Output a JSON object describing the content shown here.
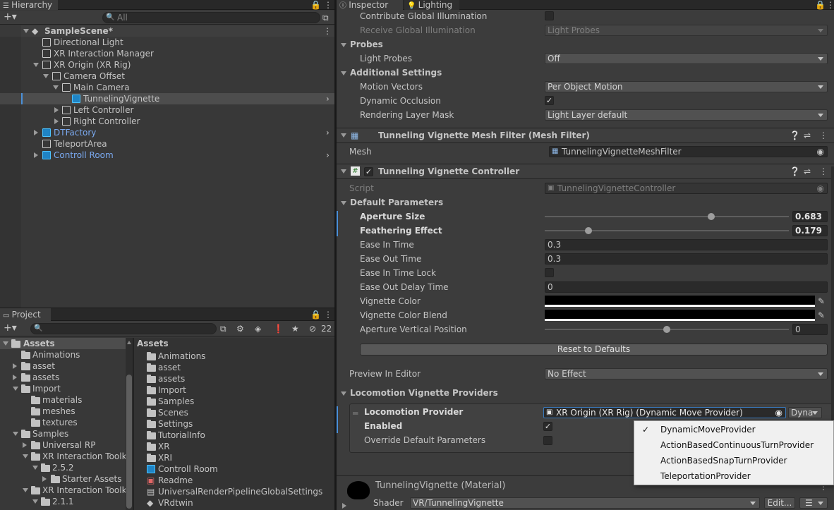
{
  "hierarchy": {
    "tab": "Hierarchy",
    "search_placeholder": "All",
    "items": [
      {
        "label": "SampleScene*"
      },
      {
        "label": "Directional Light"
      },
      {
        "label": "XR Interaction Manager"
      },
      {
        "label": "XR Origin (XR Rig)"
      },
      {
        "label": "Camera Offset"
      },
      {
        "label": "Main Camera"
      },
      {
        "label": "TunnelingVignette"
      },
      {
        "label": "Left Controller"
      },
      {
        "label": "Right Controller"
      },
      {
        "label": "DTFactory"
      },
      {
        "label": "TeleportArea"
      },
      {
        "label": "Controll Room"
      }
    ]
  },
  "project": {
    "tab": "Project",
    "hidden_count": "22",
    "tree": [
      {
        "label": "Assets"
      },
      {
        "label": "Animations"
      },
      {
        "label": "asset"
      },
      {
        "label": "assets"
      },
      {
        "label": "Import"
      },
      {
        "label": "materials"
      },
      {
        "label": "meshes"
      },
      {
        "label": "textures"
      },
      {
        "label": "Samples"
      },
      {
        "label": "Universal RP"
      },
      {
        "label": "XR Interaction Toolk"
      },
      {
        "label": "2.5.2"
      },
      {
        "label": "Starter Assets"
      },
      {
        "label": "XR Interaction Toolk"
      },
      {
        "label": "2.1.1"
      }
    ],
    "breadcrumb": "Assets",
    "files": [
      {
        "label": "Animations"
      },
      {
        "label": "asset"
      },
      {
        "label": "assets"
      },
      {
        "label": "Import"
      },
      {
        "label": "Samples"
      },
      {
        "label": "Scenes"
      },
      {
        "label": "Settings"
      },
      {
        "label": "TutorialInfo"
      },
      {
        "label": "XR"
      },
      {
        "label": "XRI"
      },
      {
        "label": "Controll Room"
      },
      {
        "label": "Readme"
      },
      {
        "label": "UniversalRenderPipelineGlobalSettings"
      },
      {
        "label": "VRdtwin"
      }
    ]
  },
  "inspector": {
    "tabs": [
      "Inspector",
      "Lighting"
    ],
    "contribute_gi": "Contribute Global Illumination",
    "receive_gi": "Receive Global Illumination",
    "receive_gi_value": "Light Probes",
    "probes_header": "Probes",
    "light_probes": "Light Probes",
    "light_probes_value": "Off",
    "additional_header": "Additional Settings",
    "motion_vectors": "Motion Vectors",
    "motion_vectors_value": "Per Object Motion",
    "dynamic_occlusion": "Dynamic Occlusion",
    "rendering_layer_mask": "Rendering Layer Mask",
    "rendering_layer_mask_value": "Light Layer default",
    "mesh_filter_title": "Tunneling Vignette Mesh Filter (Mesh Filter)",
    "mesh_label": "Mesh",
    "mesh_value": "TunnelingVignetteMeshFilter",
    "controller_title": "Tunneling Vignette Controller",
    "script_label": "Script",
    "script_value": "TunnelingVignetteController",
    "default_params": "Default Parameters",
    "aperture_size": "Aperture Size",
    "aperture_size_value": "0.683",
    "feathering": "Feathering Effect",
    "feathering_value": "0.179",
    "ease_in": "Ease In Time",
    "ease_in_value": "0.3",
    "ease_out": "Ease Out Time",
    "ease_out_value": "0.3",
    "ease_in_lock": "Ease In Time Lock",
    "ease_out_delay": "Ease Out Delay Time",
    "ease_out_delay_value": "0",
    "vignette_color": "Vignette Color",
    "vignette_color_blend": "Vignette Color Blend",
    "aperture_vertical": "Aperture Vertical Position",
    "aperture_vertical_value": "0",
    "reset_button": "Reset to Defaults",
    "preview_label": "Preview In Editor",
    "preview_value": "No Effect",
    "locomotion_header": "Locomotion Vignette Providers",
    "locomotion_provider": "Locomotion Provider",
    "locomotion_provider_value": "XR Origin (XR Rig) (Dynamic Move Provider)",
    "dyna_button": "Dyna",
    "enabled": "Enabled",
    "override_params": "Override Default Parameters",
    "material_title": "TunnelingVignette (Material)",
    "shader_label": "Shader",
    "shader_value": "VR/TunnelingVignette",
    "edit_button": "Edit...",
    "sliders": {
      "aperture": 0.683,
      "feathering": 0.179,
      "vertical": 0.5
    },
    "colors": {
      "vignette": "#000000",
      "accent": "#4a90d9"
    }
  },
  "popup": {
    "items": [
      {
        "label": "DynamicMoveProvider",
        "checked": "✓"
      },
      {
        "label": "ActionBasedContinuousTurnProvider",
        "checked": ""
      },
      {
        "label": "ActionBasedSnapTurnProvider",
        "checked": ""
      },
      {
        "label": "TeleportationProvider",
        "checked": ""
      }
    ]
  }
}
